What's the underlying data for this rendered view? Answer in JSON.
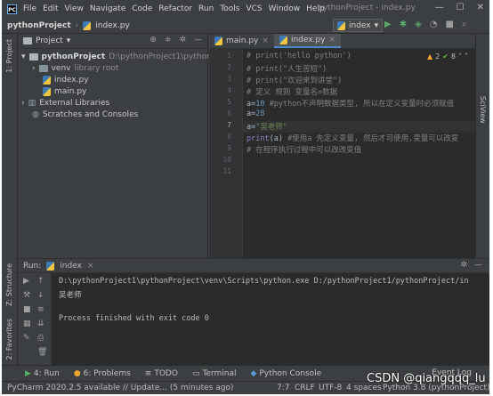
{
  "menu": {
    "items": [
      "File",
      "Edit",
      "View",
      "Navigate",
      "Code",
      "Refactor",
      "Run",
      "Tools",
      "VCS",
      "Window",
      "Help"
    ],
    "title": "pythonProject - index.py"
  },
  "nav": {
    "project": "pythonProject",
    "file": "index.py",
    "run_config": "index"
  },
  "left_stripe": {
    "project_label": "1: Project",
    "structure_label": "Z: Structure",
    "favorites_label": "2: Favorites"
  },
  "right_stripe": {
    "sciview_label": "SciView"
  },
  "project_panel": {
    "header": "Project",
    "root": "pythonProject",
    "root_path": "D:\\pythonProject1\\pythonProject",
    "venv": "venv",
    "venv_hint": "library root",
    "files": [
      "index.py",
      "main.py"
    ],
    "external": "External Libraries",
    "scratches": "Scratches and Consoles"
  },
  "editor": {
    "tabs": [
      "main.py",
      "index.py"
    ],
    "active_tab": 1,
    "warnings": "2",
    "ok_count": "8",
    "line_numbers": [
      "1",
      "2",
      "3",
      "4",
      "5",
      "6",
      "7",
      "8",
      "9",
      "10",
      "11"
    ],
    "lines": {
      "l1": "# print('hello python')",
      "l2": "# print(\"人生苦短\")",
      "l3": "# print(\"欢迎来到讲堂\")",
      "l4": "# 定义  规则  变量名=数据",
      "l5_a": "a=",
      "l5_num": "10",
      "l5_cm": "  #python不声明数据类型, 所以在定义变量时必须赋值",
      "l6_a": "a=",
      "l6_num": "28",
      "l7_a": "a=",
      "l7_str": "\"吴老师\"",
      "l8_fn": "print",
      "l8_arg": "(a)",
      "l8_cm": "  #使用a 先定义变量, 然后才可使用,变量可以改变",
      "l9": "# 在程序执行过程中可以改改变值"
    }
  },
  "run": {
    "label": "Run:",
    "tab": "index",
    "cmd": "D:\\pythonProject1\\pythonProject\\venv\\Scripts\\python.exe D:/pythonProject1/pythonProject/in",
    "output": "吴老师",
    "finished": "Process finished with exit code 0"
  },
  "bottom_tabs": {
    "run": "4: Run",
    "problems": "6: Problems",
    "todo": "TODO",
    "terminal": "Terminal",
    "console": "Python Console",
    "event_log": "Event Log"
  },
  "status": {
    "message": "PyCharm 2020.2.5 available // Update... (5 minutes ago)",
    "position": "7:7",
    "line_sep": "CRLF",
    "encoding": "UTF-8",
    "indent": "4 spaces",
    "interpreter": "Python 3.8 (pythonProject)"
  },
  "watermark": "CSDN @qiangqqq_lu"
}
